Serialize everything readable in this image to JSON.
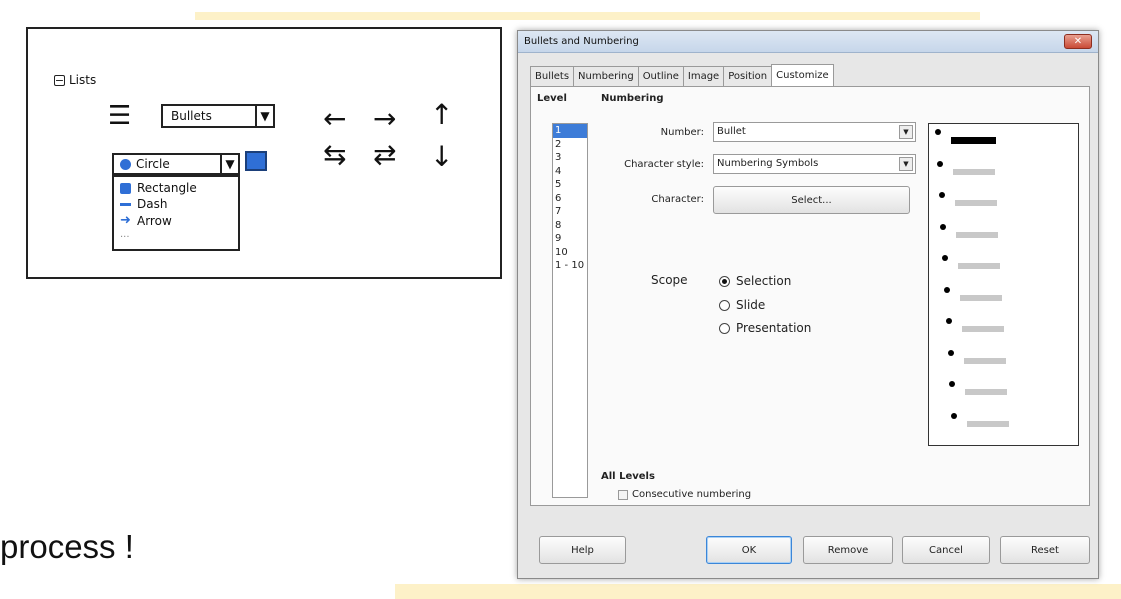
{
  "slide": {
    "text": "process !"
  },
  "mockup": {
    "tree_label": "Lists",
    "tree_toggle": "⊟",
    "list_icon": "☰",
    "bullets_select": "Bullets",
    "dd_arrow": "▼",
    "circle_select": "Circle",
    "options": [
      "Rectangle",
      "Dash",
      "Arrow"
    ],
    "more": "...",
    "arrows": [
      "←",
      "→",
      "↑",
      "⇆",
      "⇄",
      "↓"
    ]
  },
  "dialog": {
    "title": "Bullets and Numbering",
    "close": "✕",
    "tabs": [
      "Bullets",
      "Numbering",
      "Outline",
      "Image",
      "Position",
      "Customize"
    ],
    "active_tab": "Customize",
    "level_header": "Level",
    "levels": [
      "1",
      "2",
      "3",
      "4",
      "5",
      "6",
      "7",
      "8",
      "9",
      "10",
      "1 - 10"
    ],
    "selected_level": "1",
    "numbering_header": "Numbering",
    "number_label": "Number:",
    "number_value": "Bullet",
    "char_style_label": "Character style:",
    "char_style_value": "Numbering Symbols",
    "character_label": "Character:",
    "select_button": "Select...",
    "scope_label": "Scope",
    "scope_options": [
      "Selection",
      "Slide",
      "Presentation"
    ],
    "scope_selected": "Selection",
    "all_levels": "All Levels",
    "consecutive": "Consecutive numbering",
    "buttons": {
      "help": "Help",
      "ok": "OK",
      "remove": "Remove",
      "cancel": "Cancel",
      "reset": "Reset"
    }
  }
}
